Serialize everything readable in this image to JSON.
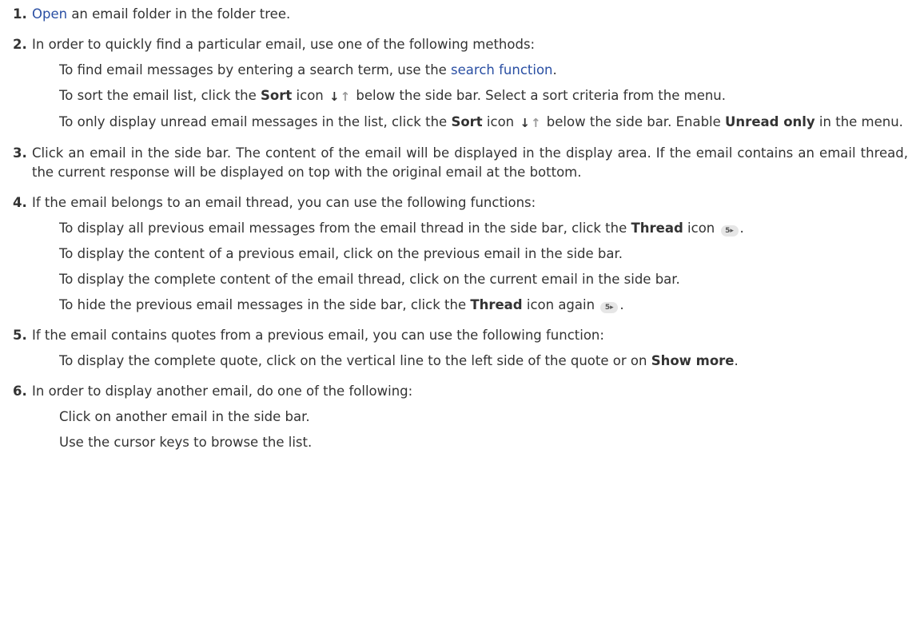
{
  "steps": [
    {
      "num": "1.",
      "open_link": "Open",
      "text": " an email folder in the folder tree."
    },
    {
      "num": "2.",
      "text": "In order to quickly find a particular email, use one of the following methods:",
      "sub1_pre": "To find email messages by entering a search term, use the ",
      "sub1_link": "search function",
      "sub1_post": ".",
      "sub2_pre": "To sort the email list, click the ",
      "sub2_bold": "Sort",
      "sub2_mid": " icon",
      "sub2_post": " below the side bar. Select a sort criteria from the menu.",
      "sub3_pre": "To only display unread email messages in the list, click the ",
      "sub3_bold": "Sort",
      "sub3_mid": " icon",
      "sub3_post": " below the side bar. Enable ",
      "sub3_bold2": "Unread only",
      "sub3_end": " in the menu."
    },
    {
      "num": "3.",
      "text": "Click an email in the side bar. The content of the email will be displayed in the display area. If the email contains an email thread, the current response will be displayed on top with the original email at the bottom."
    },
    {
      "num": "4.",
      "text": "If the email belongs to an email thread, you can use the following functions:",
      "sub1_pre": "To display all previous email messages from the email thread in the side bar, click the ",
      "sub1_bold": "Thread",
      "sub1_post": " icon",
      "sub1_end": ".",
      "sub2": "To display the content of a previous email, click on the previous email in the side bar.",
      "sub3": "To display the complete content of the email thread, click on the current email in the side bar.",
      "sub4_pre": "To hide the previous email messages in the side bar, click the ",
      "sub4_bold": "Thread",
      "sub4_post": " icon again",
      "sub4_end": "."
    },
    {
      "num": "5.",
      "text": "If the email contains quotes from a previous email, you can use the following function:",
      "sub1_pre": "To display the complete quote, click on the vertical line to the left side of the quote or on ",
      "sub1_bold": "Show more",
      "sub1_end": "."
    },
    {
      "num": "6.",
      "text": "In order to display another email, do one of the following:",
      "sub1": "Click on another email in the side bar.",
      "sub2": "Use the cursor keys to browse the list."
    }
  ],
  "icons": {
    "sort_down": "↓",
    "sort_up": "↑",
    "thread_count": "5▸"
  },
  "colors": {
    "text": "#333333",
    "link": "#2a4fa3",
    "icon_muted": "#999999",
    "thread_badge_bg": "#e6e6e6"
  }
}
